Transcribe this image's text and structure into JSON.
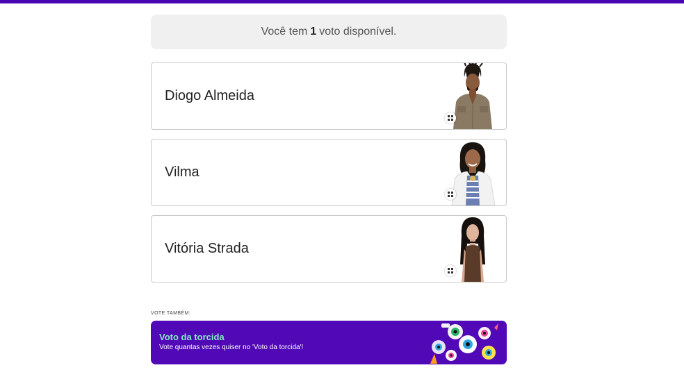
{
  "header": {
    "accent_color": "#4a05b3"
  },
  "vote_info": {
    "prefix": "Você tem",
    "count": "1",
    "suffix": "voto disponível."
  },
  "candidates": [
    {
      "name": "Diogo Almeida",
      "icon": "grid-icon"
    },
    {
      "name": "Vilma",
      "icon": "grid-icon"
    },
    {
      "name": "Vitória Strada",
      "icon": "grid-icon"
    }
  ],
  "also_vote": {
    "label": "VOTE TAMBÉM:"
  },
  "banner": {
    "title": "Voto da torcida",
    "subtitle": "Vote quantas vezes quiser no 'Voto da torcida'!",
    "background": "#5109b7",
    "title_color": "#7ff0c2"
  }
}
